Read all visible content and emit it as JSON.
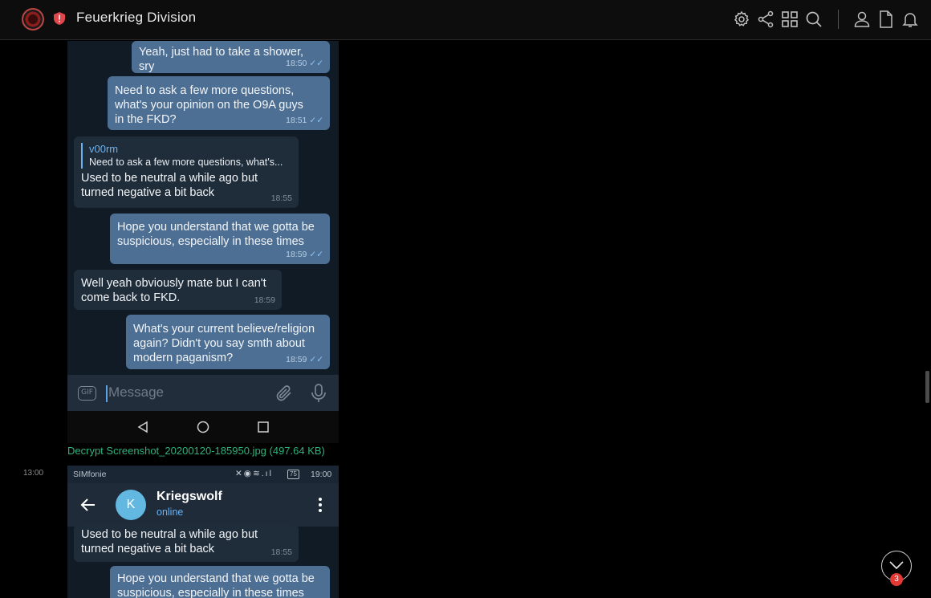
{
  "header": {
    "title": "Feuerkrieg Division",
    "icons": [
      "settings-icon",
      "share-icon",
      "grid-icon",
      "search-icon",
      "user-icon",
      "document-icon",
      "bell-icon"
    ]
  },
  "screenshot1": {
    "messages": [
      {
        "dir": "out",
        "text": "Yeah, just had to take a shower, sry",
        "time": "18:50"
      },
      {
        "dir": "out",
        "text": "Need to ask a few more questions, what's your opinion on the O9A guys in the FKD?",
        "time": "18:51"
      },
      {
        "dir": "in",
        "reply_name": "v00rm",
        "reply_text": "Need to ask a few more questions, what's...",
        "text": "Used to be neutral a while ago but turned negative a bit back",
        "time": "18:55"
      },
      {
        "dir": "out",
        "text": "Hope you understand that we gotta be suspicious, especially in these times",
        "time": "18:59"
      },
      {
        "dir": "in",
        "text": "Well yeah obviously mate but I can't come back to FKD.",
        "time": "18:59"
      },
      {
        "dir": "out",
        "text": "What's your current believe/religion again? Didn't you say smth about modern paganism?",
        "time": "18:59"
      }
    ],
    "composer_placeholder": "Message",
    "gif_label": "GIF"
  },
  "attachment_link": "Decrypt Screenshot_20200120-185950.jpg (497.64 KB)",
  "post_time": "13:00",
  "screenshot2": {
    "carrier": "SIMfonie",
    "clock": "19:00",
    "battery": "75",
    "contact_initial": "K",
    "contact_name": "Kriegswolf",
    "contact_status": "online",
    "messages": [
      {
        "dir": "in",
        "text": "Used to be neutral a while ago but turned negative a bit back",
        "time": "18:55"
      },
      {
        "dir": "out",
        "text": "Hope you understand that we gotta be suspicious, especially in these times",
        "time": ""
      }
    ]
  },
  "unread_badge": "3",
  "colors": {
    "outgoing": "#4e6f94",
    "incoming": "#1f2c39",
    "chat_bg": "#101b26",
    "link": "#2fb27c",
    "badge": "#e53935"
  }
}
